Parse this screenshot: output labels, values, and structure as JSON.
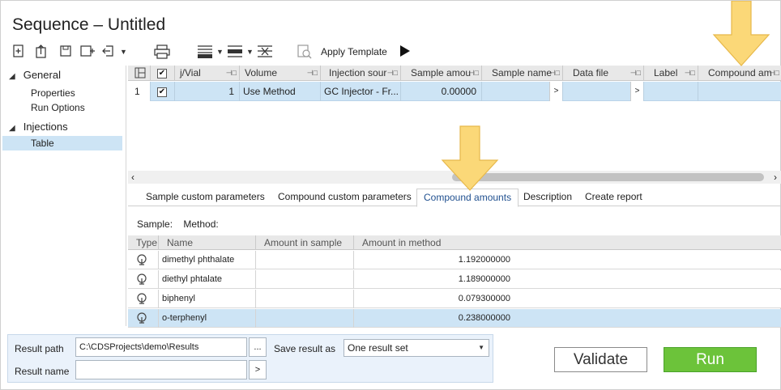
{
  "window": {
    "title": "Sequence – Untitled"
  },
  "toolbar": {
    "apply_template_label": "Apply Template",
    "icons": [
      "new-file-icon",
      "upload-icon",
      "save-icon",
      "save-as-icon",
      "import-icon",
      "print-icon",
      "insert-row-icon",
      "append-row-icon",
      "delete-row-icon",
      "template-search-icon",
      "run-triangle-icon"
    ]
  },
  "nav": {
    "groups": [
      {
        "label": "General",
        "items": [
          "Properties",
          "Run Options"
        ]
      },
      {
        "label": "Injections",
        "items": [
          "Table"
        ]
      }
    ],
    "selected": "Table"
  },
  "grid": {
    "columns": [
      "j/Vial",
      "Volume",
      "Injection sour",
      "Sample amou",
      "Sample name",
      "Data file",
      "Label",
      "Compound am"
    ],
    "rows": [
      {
        "num": "1",
        "checked": true,
        "vial": "1",
        "volume": "Use Method",
        "injection_source": "GC Injector - Fr...",
        "sample_amount": "0.00000",
        "sample_name": "",
        "data_file": "",
        "label": "",
        "compound_amount": ""
      }
    ]
  },
  "tabs": {
    "items": [
      "Sample custom parameters",
      "Compound custom parameters",
      "Compound amounts",
      "Description",
      "Create report"
    ],
    "active": "Compound amounts"
  },
  "compound_panel": {
    "sample_label": "Sample:",
    "method_label": "Method:",
    "columns": [
      "Type",
      "Name",
      "Amount in sample",
      "Amount in method"
    ],
    "rows": [
      {
        "name": "dimethyl phthalate",
        "amount_in_sample": "",
        "amount_in_method": "1.192000000"
      },
      {
        "name": "diethyl phtalate",
        "amount_in_sample": "",
        "amount_in_method": "1.189000000"
      },
      {
        "name": "biphenyl",
        "amount_in_sample": "",
        "amount_in_method": "0.079300000"
      },
      {
        "name": "o-terphenyl",
        "amount_in_sample": "",
        "amount_in_method": "0.238000000"
      }
    ],
    "selected_row": 3
  },
  "result": {
    "path_label": "Result path",
    "path_value": "C:\\CDSProjects\\demo\\Results",
    "name_label": "Result name",
    "name_value": "",
    "browse_label": "...",
    "name_button_label": ">",
    "save_as_label": "Save result as",
    "save_as_value": "One result set"
  },
  "actions": {
    "validate_label": "Validate",
    "run_label": "Run"
  },
  "colors": {
    "selection": "#cde4f5",
    "run_green": "#6cc33a",
    "arrow_yellow": "#fbd878"
  }
}
